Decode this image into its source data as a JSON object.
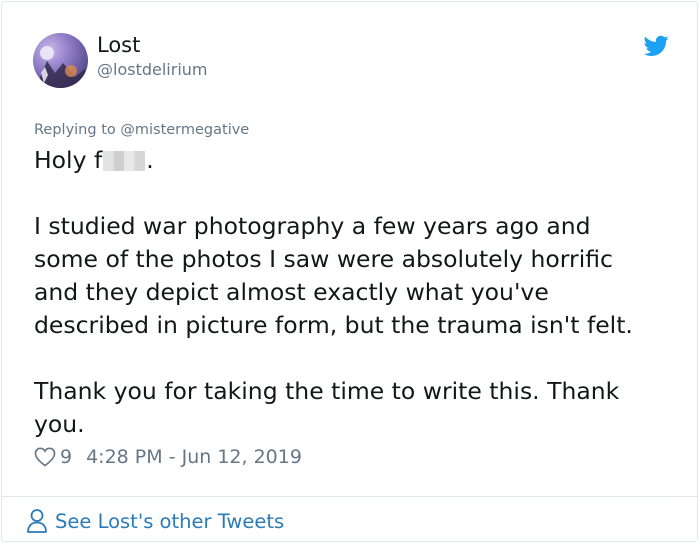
{
  "author": {
    "display_name": "Lost",
    "username": "@lostdelirium"
  },
  "reply_context": "Replying to @mistermegative",
  "tweet": {
    "line1_prefix": "Holy f",
    "line1_suffix": ".",
    "paragraph2": "I studied war photography a few years ago and\nsome of the photos I saw were absolutely horrific\nand they depict almost exactly what you've\ndescribed in picture form, but the trauma isn't felt.",
    "paragraph3": "Thank you for taking the time to write this. Thank\nyou."
  },
  "meta": {
    "like_count": "9",
    "timestamp": "4:28 PM - Jun 12, 2019"
  },
  "footer": {
    "link_label": "See Lost's other Tweets"
  },
  "icons": {
    "bird": "twitter-bird-icon",
    "heart": "heart-icon",
    "person": "person-icon"
  },
  "colors": {
    "brand_blue": "#1da1f2",
    "link_blue": "#2b7bb9",
    "muted": "#657786",
    "text": "#14171a"
  }
}
